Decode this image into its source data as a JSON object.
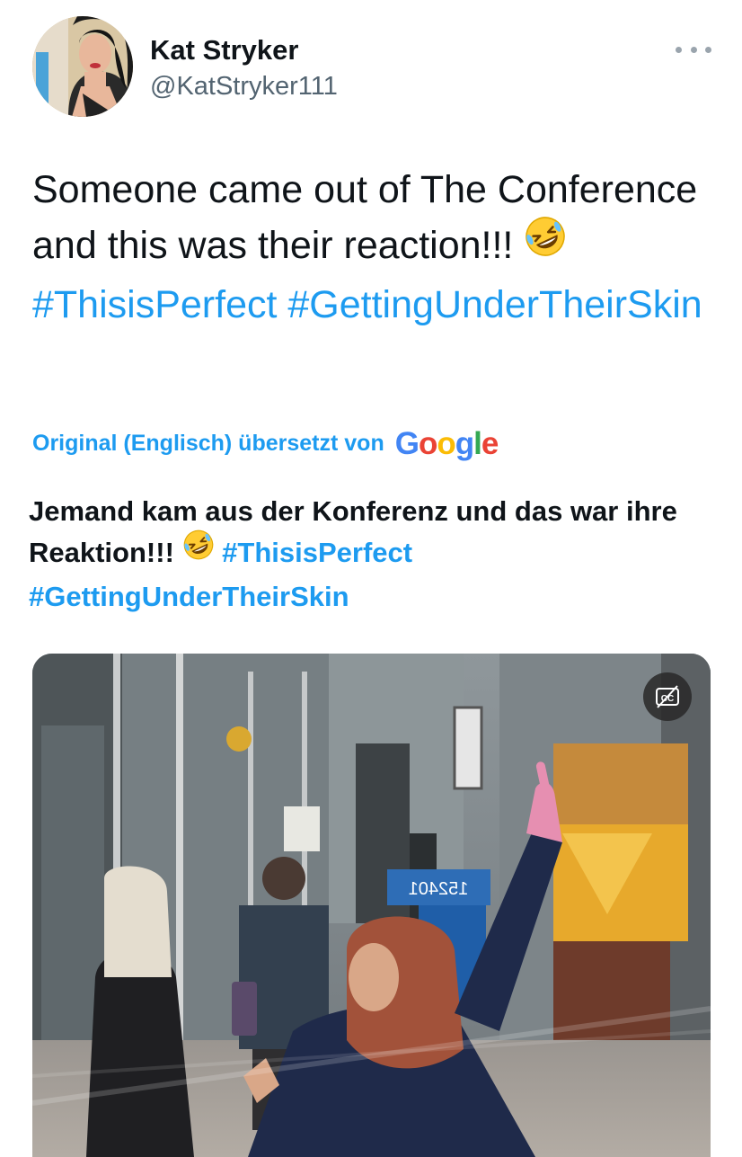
{
  "author": {
    "display_name": "Kat Stryker",
    "handle": "@KatStryker111"
  },
  "tweet": {
    "text_plain": "Someone came out of The Conference and this was their reaction!!!",
    "emoji": "rolling-on-the-floor-laughing",
    "hashtags": [
      "#ThisisPerfect",
      "#GettingUnderTheirSkin"
    ]
  },
  "translation": {
    "label": "Original (Englisch) übersetzt von",
    "provider": "Google",
    "text_plain": "Jemand kam aus der Konferenz und das war ihre Reaktion!!!",
    "hashtags": [
      "#ThisisPerfect",
      "#GettingUnderTheirSkin"
    ]
  },
  "media": {
    "type": "video",
    "scene_sign_text": "152401",
    "captions_button_icon": "closed-captions-off-icon"
  },
  "icons": {
    "more": "more-horizontal-icon",
    "avatar": "profile-photo"
  },
  "colors": {
    "link": "#1d9bf0",
    "text": "#0f1419",
    "secondary": "#536471"
  }
}
